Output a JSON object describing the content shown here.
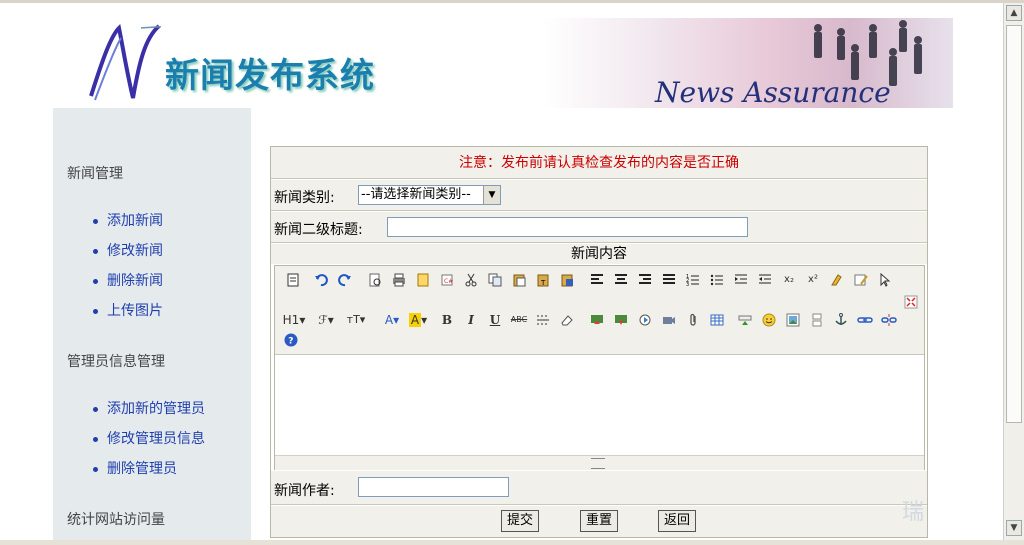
{
  "header": {
    "logo_title": "新闻发布系统",
    "banner_text": "News Assurance"
  },
  "sidebar": {
    "sections": [
      {
        "title": "新闻管理",
        "items": [
          "添加新闻",
          "修改新闻",
          "删除新闻",
          "上传图片"
        ]
      },
      {
        "title": "管理员信息管理",
        "items": [
          "添加新的管理员",
          "修改管理员信息",
          "删除管理员"
        ]
      },
      {
        "title": "统计网站访问量",
        "items": []
      }
    ]
  },
  "form": {
    "notice": "注意：发布前请认真检查发布的内容是否正确",
    "category_label": "新闻类别:",
    "category_selected": "--请选择新闻类别--",
    "subtitle_label": "新闻二级标题:",
    "subtitle_value": "",
    "content_label": "新闻内容",
    "author_label": "新闻作者:",
    "author_value": "",
    "buttons": {
      "submit": "提交",
      "reset": "重置",
      "back": "返回"
    }
  },
  "editor_toolbar": {
    "row2_text": {
      "heading": "H1",
      "font": "ℱ",
      "size": "тT",
      "color": "A",
      "bold": "B",
      "italic": "I",
      "underline": "U",
      "strike": "ABC"
    }
  },
  "watermark": "瑞"
}
